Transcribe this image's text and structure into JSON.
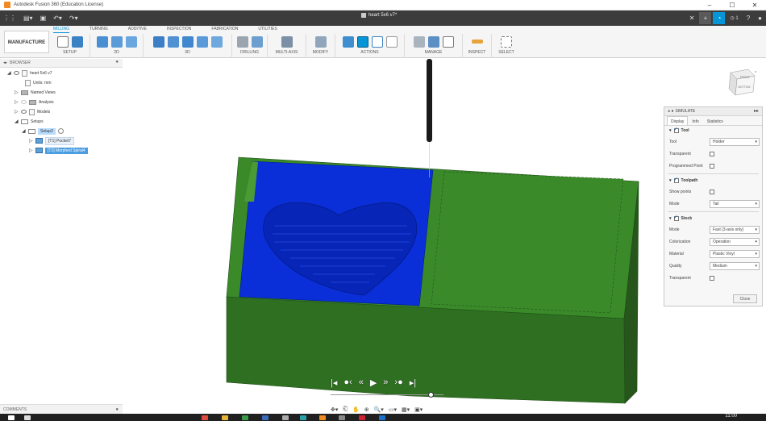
{
  "window": {
    "title": "Autodesk Fusion 360 (Education License)",
    "document_tab": "heart 5x6 v7*"
  },
  "ribbon": {
    "workspace": "MANUFACTURE",
    "tabs": [
      "MILLING",
      "TURNING",
      "ADDITIVE",
      "INSPECTION",
      "FABRICATION",
      "UTILITIES"
    ],
    "active_tab": "MILLING",
    "groups": [
      "SETUP",
      "2D",
      "3D",
      "DRILLING",
      "MULTI-AXIS",
      "MODIFY",
      "ACTIONS",
      "MANAGE",
      "INSPECT",
      "SELECT"
    ]
  },
  "browser": {
    "header": "BROWSER",
    "items": {
      "root": "heart 5x6 v7",
      "units": "Units: mm",
      "named_views": "Named Views",
      "analysis": "Analysis",
      "models": "Models",
      "setups": "Setups",
      "setup2": "Setup2",
      "op1": "[T1] Pocket7",
      "op2": "[T2] Morphed Spiral4"
    },
    "comments": "COMMENTS"
  },
  "viewcube": {
    "front": "FRONT",
    "right": "RIGHT",
    "top": "BOTTOM"
  },
  "simulate": {
    "title": "SIMULATE",
    "tabs": [
      "Display",
      "Info",
      "Statistics"
    ],
    "tool": {
      "heading": "Tool",
      "tool_label": "Tool",
      "tool_value": "Holder",
      "transparent_label": "Transparent",
      "programmed_point_label": "Programmed Point"
    },
    "toolpath": {
      "heading": "Toolpath",
      "show_points_label": "Show points",
      "mode_label": "Mode",
      "mode_value": "Tail"
    },
    "stock": {
      "heading": "Stock",
      "mode_label": "Mode",
      "mode_value": "Fast (3-axis only)",
      "colorization_label": "Colorization",
      "colorization_value": "Operation",
      "material_label": "Material",
      "material_value": "Plastic Vinyl",
      "quality_label": "Quality",
      "quality_value": "Medium",
      "transparent_label": "Transparent"
    },
    "close": "Close"
  },
  "taskbar": {
    "time": "11:00"
  },
  "colors": {
    "stock_green": "#2f6f22",
    "machined_blue": "#0a2fd8",
    "accent": "#0696d7"
  }
}
